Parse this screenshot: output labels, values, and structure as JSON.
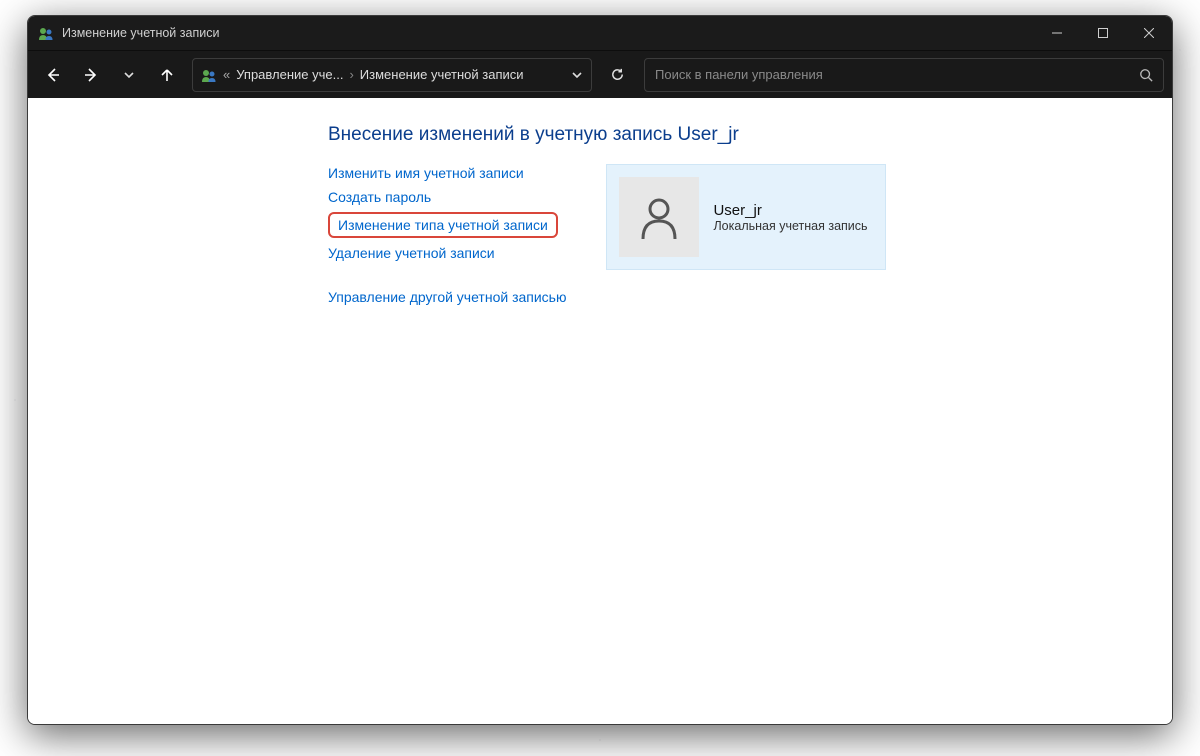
{
  "window": {
    "title": "Изменение учетной записи"
  },
  "breadcrumb": {
    "ellipsis": "«",
    "part1": "Управление уче...",
    "part2": "Изменение учетной записи"
  },
  "search": {
    "placeholder": "Поиск в панели управления"
  },
  "page": {
    "heading": "Внесение изменений в учетную запись User_jr"
  },
  "links": {
    "change_name": "Изменить имя учетной записи",
    "create_password": "Создать пароль",
    "change_type": "Изменение типа учетной записи",
    "delete_account": "Удаление учетной записи",
    "manage_other": "Управление другой учетной записью"
  },
  "user": {
    "name": "User_jr",
    "type": "Локальная учетная запись"
  }
}
